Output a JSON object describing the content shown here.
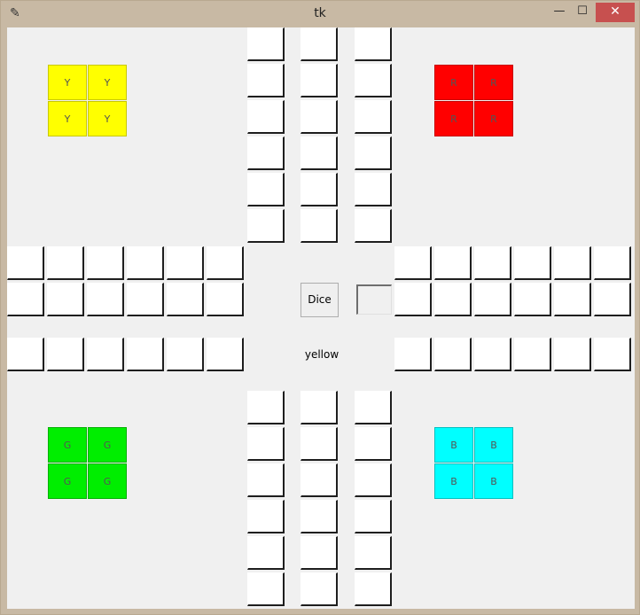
{
  "window": {
    "title": "tk",
    "minimize": "—",
    "maximize": "☐",
    "close": "✕"
  },
  "homes": {
    "yellow": {
      "color": "#ffff00",
      "border": "#c8c800",
      "pieces": [
        "Y",
        "Y",
        "Y",
        "Y"
      ]
    },
    "red": {
      "color": "#ff0000",
      "border": "#c80000",
      "pieces": [
        "R",
        "R",
        "R",
        "R"
      ]
    },
    "green": {
      "color": "#00ee00",
      "border": "#00b000",
      "pieces": [
        "G",
        "G",
        "G",
        "G"
      ]
    },
    "cyan": {
      "color": "#00ffff",
      "border": "#00c0c0",
      "pieces": [
        "B",
        "B",
        "B",
        "B"
      ]
    }
  },
  "controls": {
    "dice_label": "Dice",
    "dice_value": "",
    "turn_text": "yellow"
  }
}
